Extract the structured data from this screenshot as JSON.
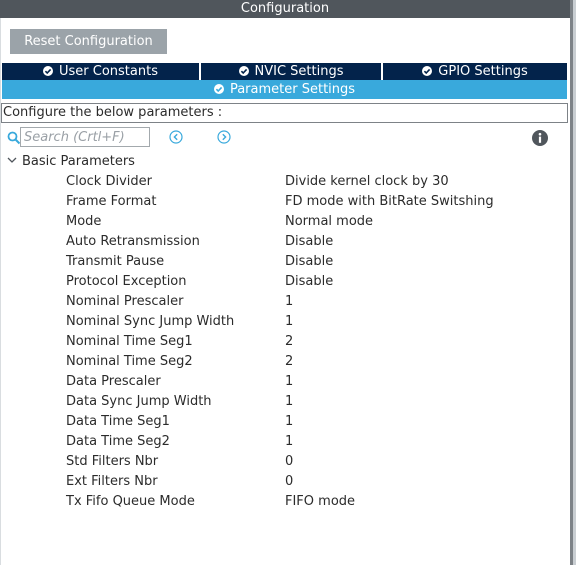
{
  "window": {
    "title": "Configuration"
  },
  "toolbar": {
    "reset_label": "Reset Configuration"
  },
  "tabs": [
    {
      "label": "User Constants",
      "icon": "check-circle-icon"
    },
    {
      "label": "NVIC Settings",
      "icon": "check-circle-icon"
    },
    {
      "label": "GPIO Settings",
      "icon": "check-circle-icon"
    }
  ],
  "active_tab": {
    "label": "Parameter Settings",
    "icon": "check-circle-icon"
  },
  "configure_label": "Configure the below parameters :",
  "search": {
    "placeholder": "Search (Crtl+F)",
    "value": ""
  },
  "group": {
    "label": "Basic Parameters",
    "expanded": true
  },
  "params": [
    {
      "name": "Clock Divider",
      "value": "Divide kernel clock by 30"
    },
    {
      "name": "Frame Format",
      "value": "FD mode with BitRate Switshing"
    },
    {
      "name": "Mode",
      "value": "Normal mode"
    },
    {
      "name": "Auto Retransmission",
      "value": "Disable"
    },
    {
      "name": "Transmit Pause",
      "value": "Disable"
    },
    {
      "name": "Protocol Exception",
      "value": "Disable"
    },
    {
      "name": "Nominal Prescaler",
      "value": "1"
    },
    {
      "name": "Nominal Sync Jump Width",
      "value": "1"
    },
    {
      "name": "Nominal Time Seg1",
      "value": "2"
    },
    {
      "name": "Nominal Time Seg2",
      "value": "2"
    },
    {
      "name": "Data Prescaler",
      "value": "1"
    },
    {
      "name": "Data Sync Jump Width",
      "value": "1"
    },
    {
      "name": "Data Time Seg1",
      "value": "1"
    },
    {
      "name": "Data Time Seg2",
      "value": "1"
    },
    {
      "name": "Std Filters Nbr",
      "value": "0"
    },
    {
      "name": "Ext Filters Nbr",
      "value": "0"
    },
    {
      "name": "Tx Fifo Queue Mode",
      "value": "FIFO mode"
    }
  ],
  "colors": {
    "title_bar": "#50565c",
    "tab_dark": "#03234b",
    "tab_active": "#39a9dc",
    "button": "#9ba3a9",
    "nav_arrow": "#39a9dc"
  }
}
